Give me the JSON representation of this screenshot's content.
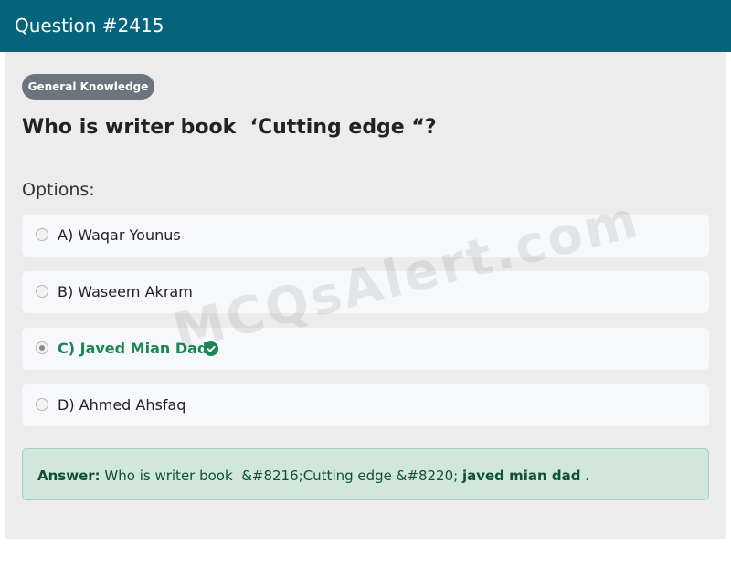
{
  "header": {
    "title": "Question #2415"
  },
  "category": {
    "label": "General Knowledge"
  },
  "question": {
    "text": "Who is writer book  ‘Cutting edge “?"
  },
  "options_label": "Options:",
  "options": [
    {
      "label": "A) Waqar Younus",
      "selected": false,
      "correct": false
    },
    {
      "label": "B) Waseem Akram",
      "selected": false,
      "correct": false
    },
    {
      "label": "C) Javed Mian Dad",
      "selected": true,
      "correct": true
    },
    {
      "label": "D) Ahmed Ahsfaq",
      "selected": false,
      "correct": false
    }
  ],
  "answer": {
    "prefix": "Answer:",
    "text": " Who is writer book  &#8216;Cutting edge &#8220; ",
    "value": "javed mian dad",
    "suffix": " ."
  },
  "watermark": "MCQsAlert.com",
  "colors": {
    "header_bg": "#05647b",
    "correct": "#198754",
    "answer_bg": "#d1e7dd"
  }
}
